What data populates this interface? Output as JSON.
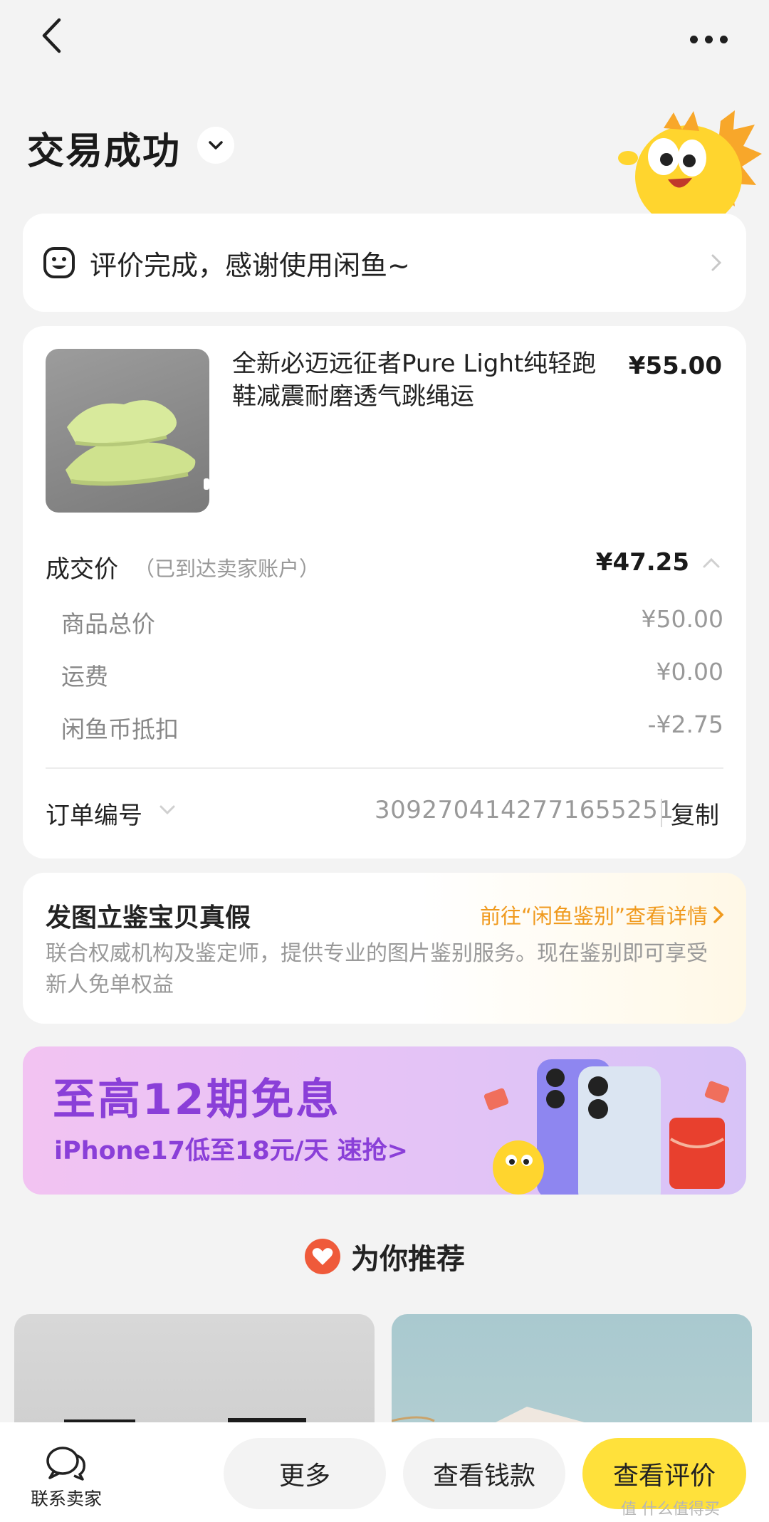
{
  "status": {
    "title": "交易成功"
  },
  "review": {
    "text": "评价完成，感谢使用闲鱼~"
  },
  "product": {
    "title": "全新必迈远征者Pure Light纯轻跑鞋减震耐磨透气跳绳运",
    "price": "¥55.00"
  },
  "deal": {
    "label": "成交价",
    "note": "（已到达卖家账户）",
    "price": "¥47.25",
    "fees": [
      {
        "label": "商品总价",
        "value": "¥50.00"
      },
      {
        "label": "运费",
        "value": "¥0.00"
      },
      {
        "label": "闲鱼币抵扣",
        "value": "-¥2.75"
      }
    ]
  },
  "order": {
    "label": "订单编号",
    "number": "3092704142771655251",
    "copy": "复制"
  },
  "authenticate": {
    "title": "发图立鉴宝贝真假",
    "link": "前往“闲鱼鉴别”查看详情",
    "description": "联合权威机构及鉴定师，提供专业的图片鉴别服务。现在鉴别即可享受新人免单权益"
  },
  "banner": {
    "title": "至高12期免息",
    "subtitle": "iPhone17低至18元/天  速抢>"
  },
  "recommend": {
    "title": "为你推荐"
  },
  "bottom": {
    "contact": "联系卖家",
    "more": "更多",
    "view_money": "查看钱款",
    "view_review": "查看评价"
  },
  "watermark": "值 什么值得买",
  "colors": {
    "accent_yellow": "#ffe13b",
    "link_orange": "#f09a1e",
    "banner_purple": "#8a3fd8",
    "heart_red": "#ef5a3a"
  }
}
